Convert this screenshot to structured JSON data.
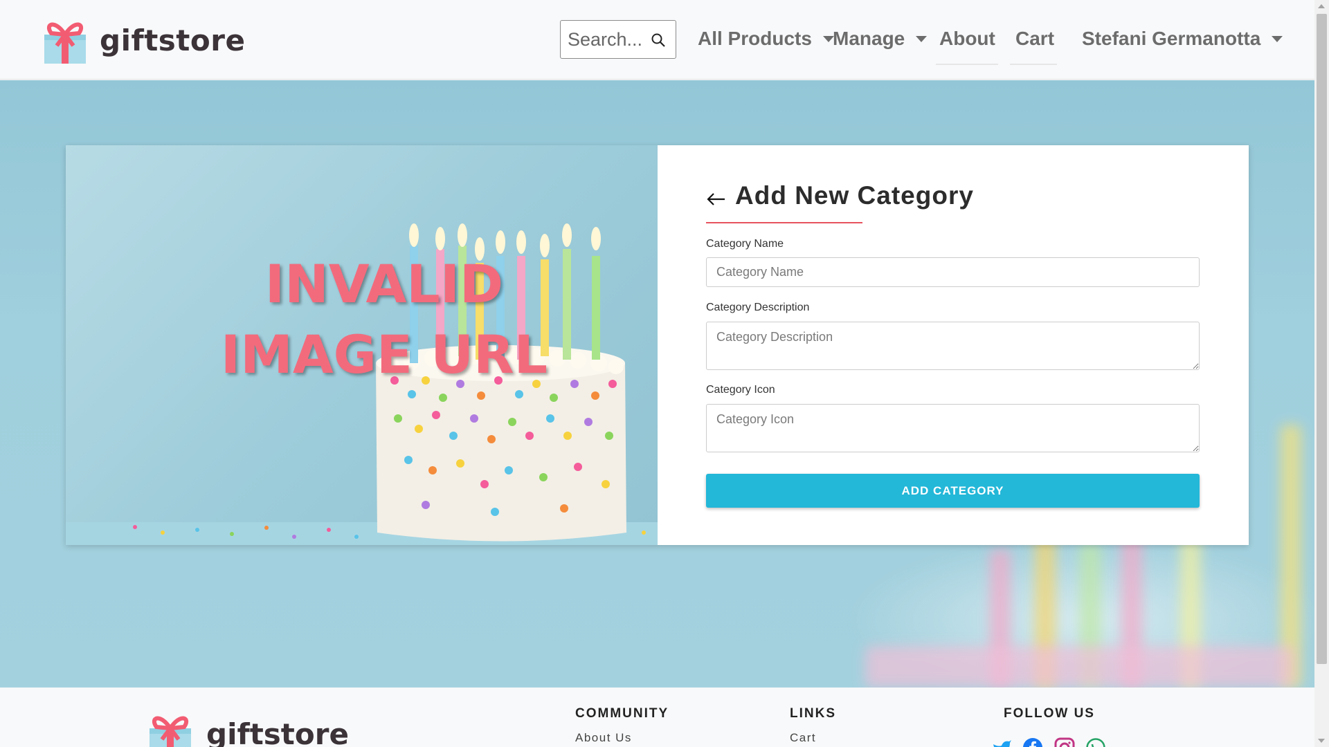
{
  "navbar": {
    "brand_name": "giftstore",
    "search_placeholder": "Search...",
    "items": [
      {
        "label": "All Products",
        "has_dropdown": true
      },
      {
        "label": "Manage",
        "has_dropdown": true
      },
      {
        "label": "About",
        "has_dropdown": false
      },
      {
        "label": "Cart",
        "has_dropdown": false
      }
    ],
    "user_name": "Stefani Germanotta"
  },
  "hero": {
    "image_error_text_line1": "INVALID",
    "image_error_text_line2": "IMAGE URL"
  },
  "form": {
    "title": "Add New Category",
    "fields": [
      {
        "label": "Category Name",
        "placeholder": "Category Name",
        "type": "input"
      },
      {
        "label": "Category Description",
        "placeholder": "Category Description",
        "type": "textarea"
      },
      {
        "label": "Category Icon",
        "placeholder": "Category Icon",
        "type": "textarea"
      }
    ],
    "submit_label": "ADD CATEGORY"
  },
  "footer": {
    "brand_name": "giftstore",
    "columns": [
      {
        "heading": "COMMUNITY",
        "link": "About Us"
      },
      {
        "heading": "LINKS",
        "link": "Cart"
      },
      {
        "heading": "FOLLOW US",
        "link": ""
      }
    ],
    "social_icons": [
      "twitter-icon",
      "facebook-icon",
      "instagram-icon",
      "whatsapp-icon"
    ]
  },
  "colors": {
    "accent": "#23b7d8",
    "title_underline": "#e8525f",
    "error_text": "#f26b7d",
    "hero_background": "#a0cfdd"
  }
}
